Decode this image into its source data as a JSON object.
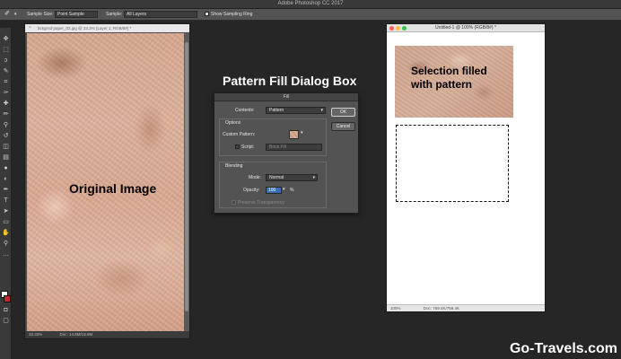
{
  "app": {
    "title": "Adobe Photoshop CC 2017"
  },
  "options_bar": {
    "sample_size_label": "Sample Size:",
    "sample_size_value": "Point Sample",
    "sample_label": "Sample:",
    "sample_value": "All Layers",
    "show_sampling_ring": "Show Sampling Ring"
  },
  "original_doc": {
    "tab_title": "bckgrnd-paper_02.jpg @ 33.3% (Layer 1, RGB/8#) *",
    "zoom": "33.33%",
    "doc_size": "Doc: 14.8M/14.8M",
    "label": "Original Image"
  },
  "dialog_caption": "Pattern Fill Dialog Box",
  "fill_dialog": {
    "title": "Fill",
    "contents_label": "Contents:",
    "contents_value": "Pattern",
    "options_label": "Options",
    "custom_pattern_label": "Custom Pattern:",
    "script_label": "Script:",
    "script_value": "Brick Fill",
    "blending_label": "Blending",
    "mode_label": "Mode:",
    "mode_value": "Normal",
    "opacity_label": "Opacity:",
    "opacity_value": "100",
    "opacity_unit": "%",
    "preserve_transparency": "Preserve Transparency",
    "ok_label": "OK",
    "cancel_label": "Cancel"
  },
  "untitled_doc": {
    "title": "Untitled-1 @ 100% (RGB/8#) *",
    "filled_label_line1": "Selection filled",
    "filled_label_line2": "with pattern",
    "zoom": "100%",
    "doc_size": "Doc: 759.4K/759.4K"
  },
  "watermark": "Go-Travels.com",
  "colors": {
    "foreground": "#ffffff",
    "background": "#c0262c",
    "traffic_close": "#fc605c",
    "traffic_min": "#fdbc40",
    "traffic_max": "#34c84a"
  }
}
